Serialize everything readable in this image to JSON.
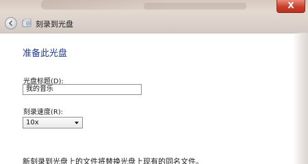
{
  "window": {
    "close_label": "X",
    "title": "刻录到光盘"
  },
  "content": {
    "heading": "准备此光盘",
    "disc_title_label": "光盘标题(D):",
    "disc_title_value": "我的音乐",
    "speed_label": "刻录速度(R):",
    "speed_value": "10x",
    "note": "新刻录到光盘上的文件将替换光盘上现有的同名文件。"
  },
  "icons": [
    "back-arrow-icon",
    "disc-icon",
    "close-icon",
    "chevron-down-icon"
  ],
  "colors": {
    "heading": "#1e3a8a",
    "close_button": "#c8402c"
  }
}
